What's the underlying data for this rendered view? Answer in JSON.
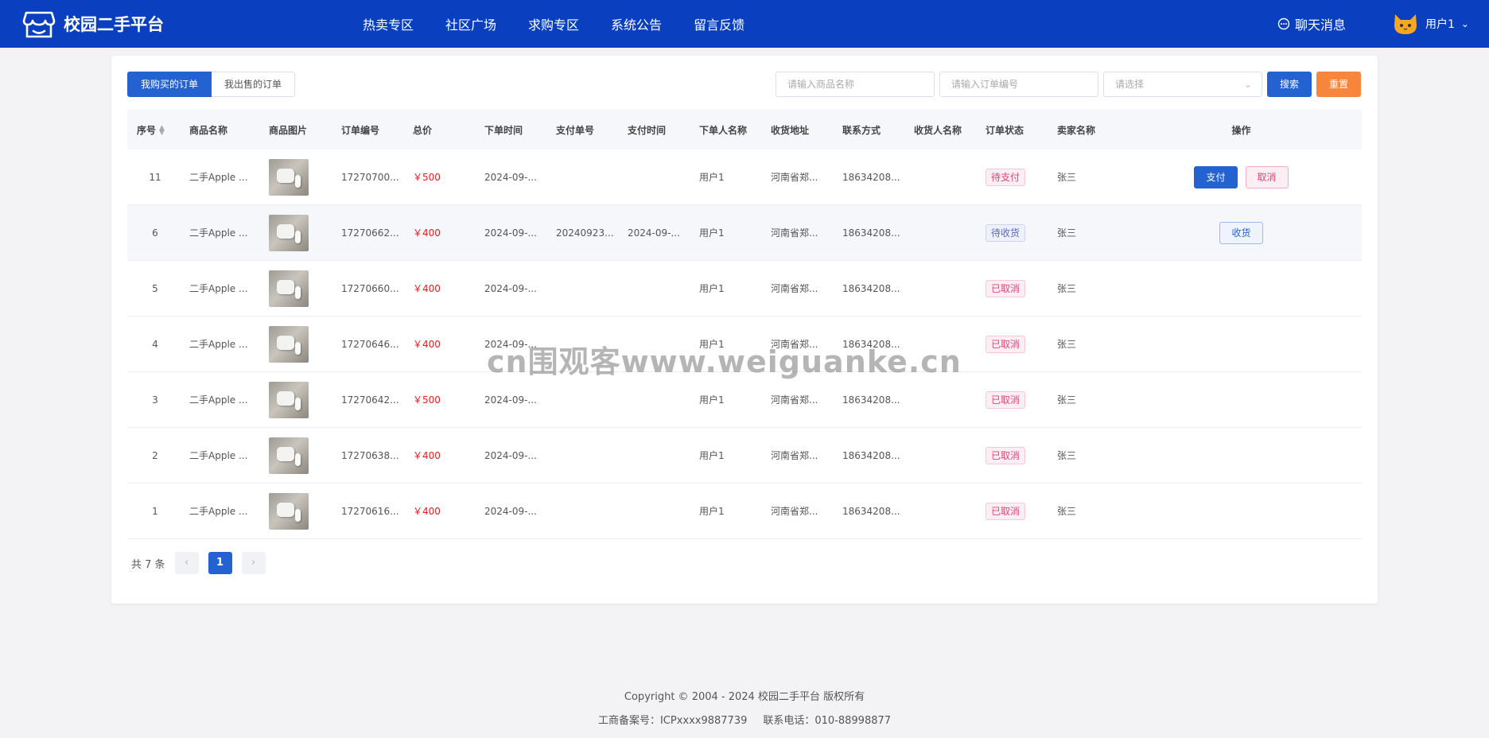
{
  "header": {
    "app_title": "校园二手平台",
    "nav": [
      "热卖专区",
      "社区广场",
      "求购专区",
      "系统公告",
      "留言反馈"
    ],
    "chat_label": "聊天消息",
    "user_name": "用户1",
    "accent_color": "#0a40c0"
  },
  "tabs": {
    "bought": "我购买的订单",
    "sold": "我出售的订单"
  },
  "filters": {
    "product_placeholder": "请输入商品名称",
    "order_placeholder": "请输入订单编号",
    "select_placeholder": "请选择",
    "search_label": "搜索",
    "reset_label": "重置"
  },
  "table": {
    "columns": [
      "序号",
      "商品名称",
      "商品图片",
      "订单编号",
      "总价",
      "下单时间",
      "支付单号",
      "支付时间",
      "下单人名称",
      "收货地址",
      "联系方式",
      "收货人名称",
      "订单状态",
      "卖家名称",
      "操作"
    ],
    "rows": [
      {
        "idx": "11",
        "name": "二手Apple ...",
        "order": "17270700...",
        "price": "￥500",
        "time": "2024-09-...",
        "payno": "",
        "paytime": "",
        "buyer": "用户1",
        "addr": "河南省郑...",
        "phone": "18634208...",
        "recv": "",
        "status": "待支付",
        "seller": "张三",
        "ops": [
          "支付",
          "取消"
        ]
      },
      {
        "idx": "6",
        "name": "二手Apple ...",
        "order": "17270662...",
        "price": "￥400",
        "time": "2024-09-...",
        "payno": "20240923...",
        "paytime": "2024-09-...",
        "buyer": "用户1",
        "addr": "河南省郑...",
        "phone": "18634208...",
        "recv": "",
        "status": "待收货",
        "seller": "张三",
        "ops": [
          "收货"
        ]
      },
      {
        "idx": "5",
        "name": "二手Apple ...",
        "order": "17270660...",
        "price": "￥400",
        "time": "2024-09-...",
        "payno": "",
        "paytime": "",
        "buyer": "用户1",
        "addr": "河南省郑...",
        "phone": "18634208...",
        "recv": "",
        "status": "已取消",
        "seller": "张三",
        "ops": []
      },
      {
        "idx": "4",
        "name": "二手Apple ...",
        "order": "17270646...",
        "price": "￥400",
        "time": "2024-09-...",
        "payno": "",
        "paytime": "",
        "buyer": "用户1",
        "addr": "河南省郑...",
        "phone": "18634208...",
        "recv": "",
        "status": "已取消",
        "seller": "张三",
        "ops": []
      },
      {
        "idx": "3",
        "name": "二手Apple ...",
        "order": "17270642...",
        "price": "￥500",
        "time": "2024-09-...",
        "payno": "",
        "paytime": "",
        "buyer": "用户1",
        "addr": "河南省郑...",
        "phone": "18634208...",
        "recv": "",
        "status": "已取消",
        "seller": "张三",
        "ops": []
      },
      {
        "idx": "2",
        "name": "二手Apple ...",
        "order": "17270638...",
        "price": "￥400",
        "time": "2024-09-...",
        "payno": "",
        "paytime": "",
        "buyer": "用户1",
        "addr": "河南省郑...",
        "phone": "18634208...",
        "recv": "",
        "status": "已取消",
        "seller": "张三",
        "ops": []
      },
      {
        "idx": "1",
        "name": "二手Apple ...",
        "order": "17270616...",
        "price": "￥400",
        "time": "2024-09-...",
        "payno": "",
        "paytime": "",
        "buyer": "用户1",
        "addr": "河南省郑...",
        "phone": "18634208...",
        "recv": "",
        "status": "已取消",
        "seller": "张三",
        "ops": []
      }
    ]
  },
  "pagination": {
    "total": "共 7 条",
    "prev": "‹",
    "current": "1",
    "next": "›"
  },
  "footer": {
    "copyright": "Copyright © 2004 - 2024 校园二手平台 版权所有",
    "icp": "工商备案号：ICPxxxx9887739",
    "phone": "联系电话：010-88998877"
  },
  "watermark": "cn围观客www.weiguanke.cn"
}
